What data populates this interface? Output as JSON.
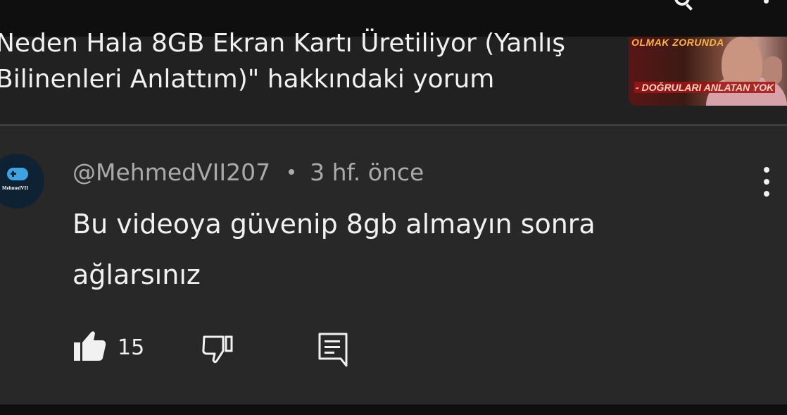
{
  "header": {
    "video_title": "Neden Hala 8GB Ekran Kartı Üretiliyor (Yanlış\nBilinenleri Anlattım)\" hakkındaki yorum",
    "thumbnail": {
      "text_top": "OLMAK ZORUNDA",
      "text_bottom": "- DOĞRULARI ANLATAN YOK"
    }
  },
  "comment": {
    "avatar_text": "MehmedVII",
    "author": "@MehmedVII207",
    "separator": "•",
    "time": "3 hf. önce",
    "text": "Bu videoya güvenip 8gb almayın sonra\nağlarsınız",
    "likes": "15"
  },
  "icons": {
    "like": "thumbs-up-icon",
    "dislike": "thumbs-down-icon",
    "reply": "reply-comment-icon",
    "menu": "more-vert-icon"
  },
  "colors": {
    "background": "#212121",
    "comment_background": "#282828",
    "top_bar": "#0f0f0f",
    "text_primary": "#f1f1f1",
    "text_secondary": "#aaaaaa"
  }
}
